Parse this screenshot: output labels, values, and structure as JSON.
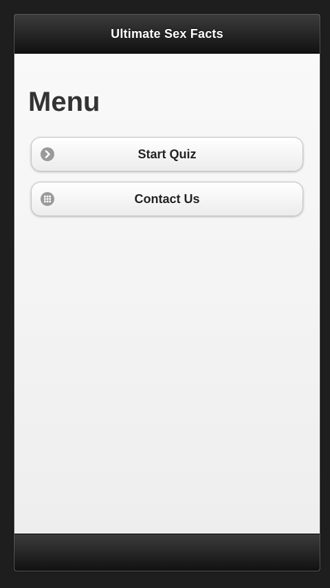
{
  "header": {
    "title": "Ultimate Sex Facts"
  },
  "main": {
    "heading": "Menu",
    "menu_items": [
      {
        "label": "Start Quiz",
        "icon": "arrow-right-icon"
      },
      {
        "label": "Contact Us",
        "icon": "grid-icon"
      }
    ]
  },
  "colors": {
    "header_bg": "#1c1c1c",
    "content_bg": "#f4f4f4",
    "button_text": "#222222",
    "icon_bg": "#9a9a9a"
  }
}
